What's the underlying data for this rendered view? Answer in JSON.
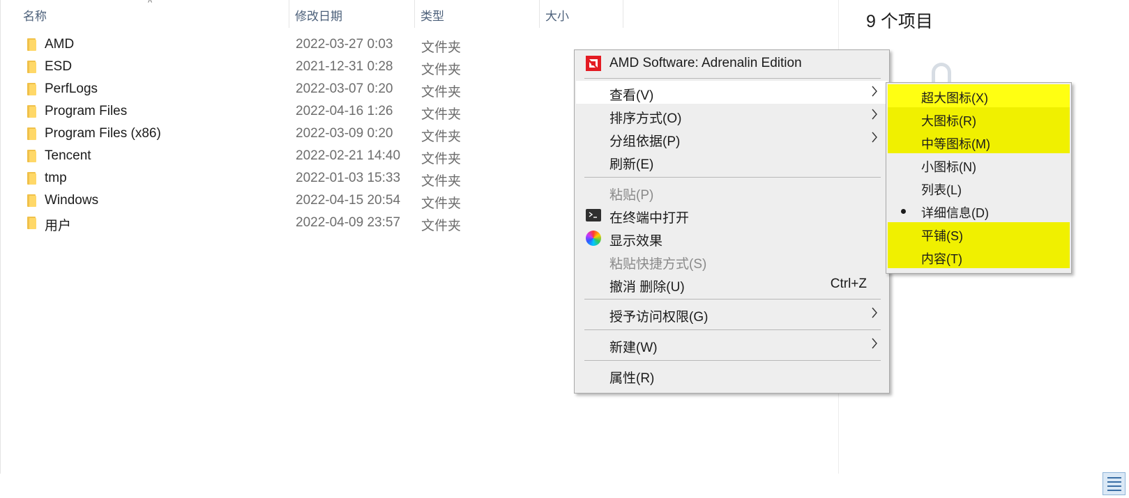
{
  "columns": {
    "name": "名称",
    "date": "修改日期",
    "type": "类型",
    "size": "大小"
  },
  "files": [
    {
      "name": "AMD",
      "date": "2022-03-27 0:03",
      "type": "文件夹"
    },
    {
      "name": "ESD",
      "date": "2021-12-31 0:28",
      "type": "文件夹"
    },
    {
      "name": "PerfLogs",
      "date": "2022-03-07 0:20",
      "type": "文件夹"
    },
    {
      "name": "Program Files",
      "date": "2022-04-16 1:26",
      "type": "文件夹"
    },
    {
      "name": "Program Files (x86)",
      "date": "2022-03-09 0:20",
      "type": "文件夹"
    },
    {
      "name": "Tencent",
      "date": "2022-02-21 14:40",
      "type": "文件夹"
    },
    {
      "name": "tmp",
      "date": "2022-01-03 15:33",
      "type": "文件夹"
    },
    {
      "name": "Windows",
      "date": "2022-04-15 20:54",
      "type": "文件夹"
    },
    {
      "name": "用户",
      "date": "2022-04-09 23:57",
      "type": "文件夹"
    }
  ],
  "preview": {
    "item_count": "9 个项目"
  },
  "context_menu": {
    "amd": "AMD Software: Adrenalin Edition",
    "view": "查看(V)",
    "sort": "排序方式(O)",
    "group": "分组依据(P)",
    "refresh": "刷新(E)",
    "paste": "粘贴(P)",
    "terminal": "在终端中打开",
    "display": "显示效果",
    "paste_shortcut": "粘贴快捷方式(S)",
    "undo": "撤消 删除(U)",
    "undo_shortcut": "Ctrl+Z",
    "access": "授予访问权限(G)",
    "new": "新建(W)",
    "properties": "属性(R)"
  },
  "view_submenu": {
    "extra_large": "超大图标(X)",
    "large": "大图标(R)",
    "medium": "中等图标(M)",
    "small": "小图标(N)",
    "list": "列表(L)",
    "details": "详细信息(D)",
    "tiles": "平铺(S)",
    "content": "内容(T)",
    "selected": "详细信息(D)",
    "highlight_color": "#f0f000"
  }
}
